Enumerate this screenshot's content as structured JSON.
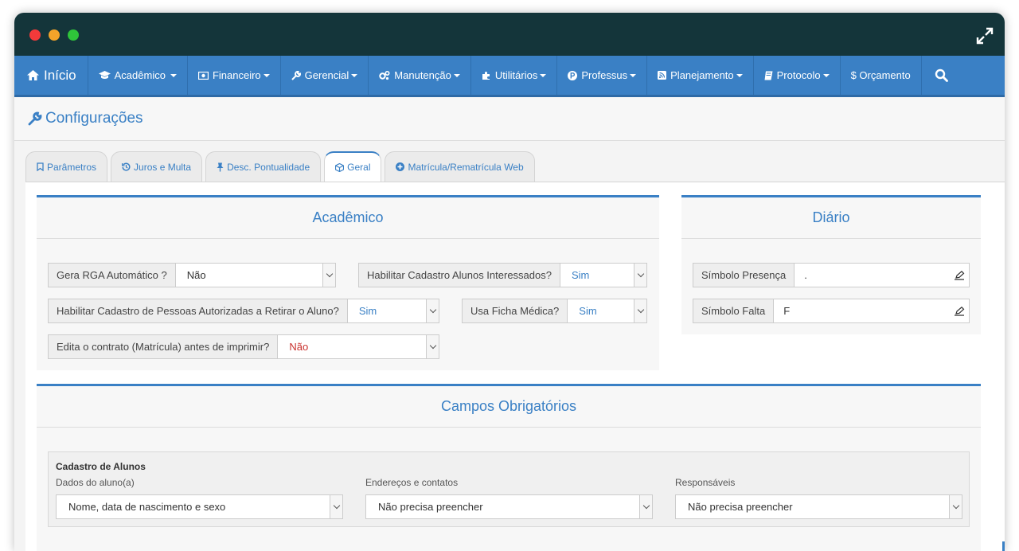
{
  "navbar": {
    "home": "Início",
    "items": [
      {
        "label": "Acadêmico",
        "icon": "graduation-cap-icon"
      },
      {
        "label": "Financeiro",
        "icon": "money-icon"
      },
      {
        "label": "Gerencial",
        "icon": "wrench-icon"
      },
      {
        "label": "Manutenção",
        "icon": "cogs-icon"
      },
      {
        "label": "Utilitários",
        "icon": "puzzle-icon"
      },
      {
        "label": "Professus",
        "icon": "p-circle-icon"
      },
      {
        "label": "Planejamento",
        "icon": "rss-icon"
      },
      {
        "label": "Protocolo",
        "icon": "book-icon"
      },
      {
        "label": "$ Orçamento",
        "icon": ""
      }
    ]
  },
  "page": {
    "title": "Configurações"
  },
  "tabs": [
    {
      "label": "Parâmetros",
      "icon": "bookmark-icon"
    },
    {
      "label": "Juros e Multa",
      "icon": "history-icon"
    },
    {
      "label": "Desc. Pontualidade",
      "icon": "pin-icon"
    },
    {
      "label": "Geral",
      "icon": "cube-icon"
    },
    {
      "label": "Matrícula/Rematrícula Web",
      "icon": "plus-circle-icon"
    }
  ],
  "academico": {
    "title": "Acadêmico",
    "fields": [
      {
        "label": "Gera RGA Automático ?",
        "value": "Não"
      },
      {
        "label": "Habilitar Cadastro Alunos Interessados?",
        "value": "Sim"
      },
      {
        "label": "Habilitar Cadastro de Pessoas Autorizadas a Retirar o Aluno?",
        "value": "Sim"
      },
      {
        "label": "Usa Ficha Médica?",
        "value": "Sim"
      },
      {
        "label": "Edita o contrato (Matrícula) antes de imprimir?",
        "value": "Não"
      }
    ]
  },
  "diario": {
    "title": "Diário",
    "fields": [
      {
        "label": "Símbolo Presença",
        "value": "."
      },
      {
        "label": "Símbolo Falta",
        "value": "F"
      }
    ]
  },
  "campos": {
    "title": "Campos Obrigatórios",
    "section_title": "Cadastro de Alunos",
    "columns": [
      {
        "label": "Dados do aluno(a)",
        "value": "Nome, data de nascimento e sexo"
      },
      {
        "label": "Endereços e contatos",
        "value": "Não precisa preencher"
      },
      {
        "label": "Responsáveis",
        "value": "Não precisa preencher"
      }
    ]
  },
  "colors": {
    "accent": "#3a80c5",
    "titlebar": "#14353a",
    "negative": "#c9302c"
  }
}
